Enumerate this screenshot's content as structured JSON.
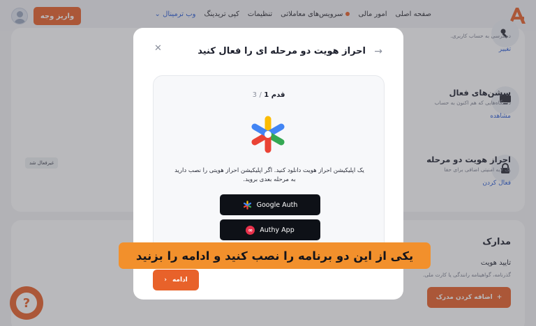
{
  "nav": {
    "items": [
      "صفحه اصلی",
      "امور مالی",
      "سرویس‌های معاملاتی",
      "تنظیمات",
      "کپی تریدینگ",
      "وب ترمینال"
    ],
    "deposit_label": "واریز وجه"
  },
  "bg": {
    "access_desc": "دسترسی به حساب کاربری.",
    "access_action": "تغییر",
    "sessions_title": "سشن‌های فعال",
    "sessions_desc": "دستگاه‌هایی که هم اکنون به حساب",
    "sessions_action": "مشاهده",
    "twofa_title": "احراز هویت دو مرحله",
    "twofa_desc": "یک لایه امنیتی اضافی برای حفا",
    "twofa_action": "فعال کردن",
    "twofa_status": "غیرفعال شد",
    "docs_title": "مدارک",
    "verify_title": "تایید هویت",
    "verify_desc": "گذرنامه، گواهینامه رانندگی یا کارت ملی.",
    "add_doc_label": "اضافه کردن مدرک"
  },
  "modal": {
    "title": "احراز هویت دو مرحله ای را فعال کنید",
    "step_label": "قدم",
    "step_current": "1",
    "step_total": "3",
    "description": "یک اپلیکیشن احراز هویت دانلود کنید. اگر اپلیکیشن احراز هویتی را نصب دارید به مرحله بعدی بروید.",
    "buttons": {
      "google_auth": "Google Auth",
      "authy": "Authy App"
    },
    "continue_label": "ادامه"
  },
  "caption": "یکی از این دو برنامه را نصب کنید و ادامه را بزنید",
  "colors": {
    "accent": "#e8622a",
    "link": "#2b5cd6",
    "caption_bg": "#f2902c"
  }
}
